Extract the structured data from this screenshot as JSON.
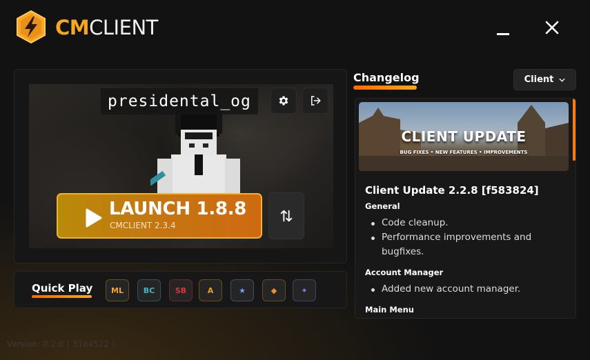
{
  "brand": {
    "cm": "CM",
    "client": "CLIENT"
  },
  "player": {
    "username": "presidental_og"
  },
  "launch": {
    "title": "LAUNCH 1.8.8",
    "subtitle": "CMCLIENT 2.3.4"
  },
  "quick_play": {
    "label": "Quick Play",
    "servers": [
      {
        "name": "server-1",
        "icon": "server-logo",
        "text": "ML",
        "color": "#f5a623"
      },
      {
        "name": "server-2",
        "icon": "server-logo",
        "text": "BC",
        "color": "#3fb6c4"
      },
      {
        "name": "server-3",
        "icon": "server-logo",
        "text": "SB",
        "color": "#e0313b"
      },
      {
        "name": "server-4",
        "icon": "server-logo",
        "text": "A",
        "color": "#f0a012"
      },
      {
        "name": "server-5",
        "icon": "server-logo",
        "text": "★",
        "color": "#6fa2e8"
      },
      {
        "name": "server-6",
        "icon": "server-logo",
        "text": "◆",
        "color": "#f08a3a"
      },
      {
        "name": "server-7",
        "icon": "server-logo",
        "text": "✦",
        "color": "#9b6cf0"
      }
    ]
  },
  "changelog": {
    "title": "Changelog",
    "filter": "Client",
    "banner": {
      "title": "CLIENT UPDATE",
      "subtitle": "BUG FIXES • NEW FEATURES • IMPROVEMENTS"
    },
    "update_title": "Client Update 2.2.8 [f583824]",
    "sections": [
      {
        "heading": "General",
        "items": [
          "Code cleanup.",
          "Performance improvements and bugfixes."
        ]
      },
      {
        "heading": "Account Manager",
        "items": [
          "Added new account manager."
        ]
      },
      {
        "heading": "Main Menu",
        "items": []
      }
    ]
  },
  "version": "Version: 0.2.0 ( 31e4522 )",
  "colors": {
    "accent": "#f5a623",
    "launch_from": "#b98a0a",
    "launch_to": "#cf6a10"
  }
}
